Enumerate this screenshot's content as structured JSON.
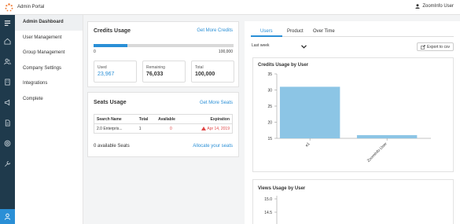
{
  "header": {
    "app_title": "Admin Portal",
    "user_name": "ZoomInfo User"
  },
  "menu": {
    "items": [
      {
        "label": "Admin Dashboard",
        "active": true
      },
      {
        "label": "User Management",
        "active": false
      },
      {
        "label": "Group Management",
        "active": false
      },
      {
        "label": "Company Settings",
        "active": false
      },
      {
        "label": "Integrations",
        "active": false
      },
      {
        "label": "Complete",
        "active": false
      }
    ]
  },
  "credits": {
    "title": "Credits Usage",
    "link": "Get More Credits",
    "progress_fraction": 0.24,
    "scale_min": "0",
    "scale_max": "100,000",
    "used_label": "Used",
    "used_value": "23,967",
    "remaining_label": "Remaining",
    "remaining_value": "76,033",
    "total_label": "Total",
    "total_value": "100,000"
  },
  "seats": {
    "title": "Seats Usage",
    "link": "Get More Seats",
    "columns": [
      "Search Name",
      "Total",
      "Available",
      "Expiration"
    ],
    "rows": [
      [
        "2.0 Enterpris...",
        "1",
        "0",
        "Apr 14, 2019"
      ]
    ],
    "available_text": "0 available Seats",
    "allocate_link": "Allocate your seats"
  },
  "tabs": [
    "Users",
    "Product",
    "Over Time"
  ],
  "filter": {
    "value": "Last week"
  },
  "export_label": "Export to csv",
  "chart_data": [
    {
      "type": "bar",
      "title": "Credits Usage by User",
      "categories": [
        "e1",
        "ZoomInfo User"
      ],
      "values": [
        31,
        16
      ],
      "ylim": [
        15,
        35
      ],
      "yticks": [
        15,
        20,
        25,
        30,
        35
      ],
      "color": "#8cc5e5"
    },
    {
      "type": "bar",
      "title": "Views Usage by User",
      "yticks": [
        15.0,
        14.5
      ]
    }
  ],
  "colors": {
    "accent": "#2a8fd6",
    "rail": "#1f3a4c",
    "bar": "#8cc5e5",
    "warning": "#e04848"
  }
}
